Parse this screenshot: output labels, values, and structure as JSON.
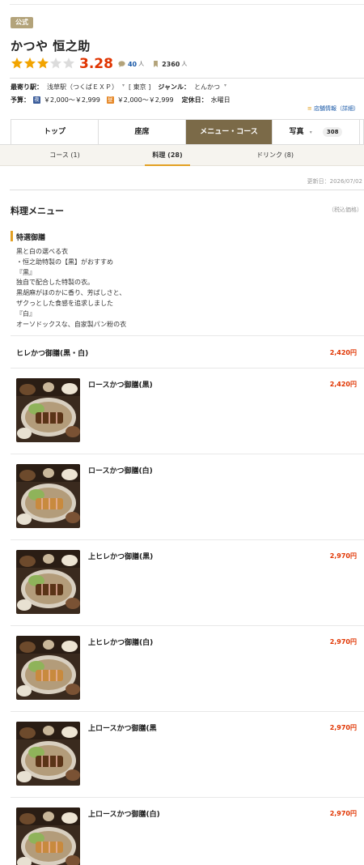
{
  "store": {
    "badge": "公式",
    "name": "かつや 恒之助",
    "score": "3.28",
    "reviews": "40",
    "reviews_unit": "人",
    "bookmarks": "2360",
    "bookmarks_unit": "人",
    "rating_stars": 3
  },
  "info": {
    "station_label": "最寄り駅：",
    "station": "浅草駅（つくばＥＸＰ）",
    "area": "[ 東京 ]",
    "genre_label": "ジャンル：",
    "genre": "とんかつ",
    "budget_label": "予算：",
    "dinner_icon": "夜",
    "dinner_price": "￥2,000～￥2,999",
    "lunch_icon": "昼",
    "lunch_price": "￥2,000～￥2,999",
    "holiday_label": "定休日：",
    "holiday": "水曜日",
    "detail_link": "店舗情報（詳細）"
  },
  "tabs": [
    {
      "label": "トップ"
    },
    {
      "label": "座席"
    },
    {
      "label": "メニュー・コース"
    },
    {
      "label": "写真",
      "count": "308"
    }
  ],
  "subtabs": [
    {
      "label": "コース (1)"
    },
    {
      "label": "料理 (28)"
    },
    {
      "label": "ドリンク (8)"
    }
  ],
  "updated": "更新日：2026/07/02",
  "menu": {
    "title": "料理メニュー",
    "tax_note": "（税込価格）",
    "category": "特選御膳",
    "description": [
      "黒と白の選べる衣",
      "・恒之助特製の【黒】がおすすめ",
      "『黒』",
      "独自で配合した特製の衣。",
      "黒胡麻がほのかに香り、芳ばしさと、",
      "ザクっとした食感を追求しました",
      "『白』",
      "オーソドックスな、自家製パン粉の衣"
    ],
    "simple_item": {
      "name": "ヒレかつ御膳(黒・白)",
      "price": "2,420円"
    },
    "items": [
      {
        "name": "ロースかつ御膳(黒)",
        "price": "2,420円",
        "coating": "black"
      },
      {
        "name": "ロースかつ御膳(白)",
        "price": "",
        "coating": "white"
      },
      {
        "name": "上ヒレかつ御膳(黒)",
        "price": "2,970円",
        "coating": "black"
      },
      {
        "name": "上ヒレかつ御膳(白)",
        "price": "2,970円",
        "coating": "white"
      },
      {
        "name": "上ロースかつ御膳(黒",
        "price": "2,970円",
        "coating": "black"
      },
      {
        "name": "上ロースかつ御膳(白)",
        "price": "2,970円",
        "coating": "white"
      }
    ]
  },
  "colors": {
    "accent": "#e03400",
    "tab_active": "#7b6a48",
    "link": "#1b5aa8",
    "underline": "#e3a023",
    "star": "#f2a400"
  }
}
